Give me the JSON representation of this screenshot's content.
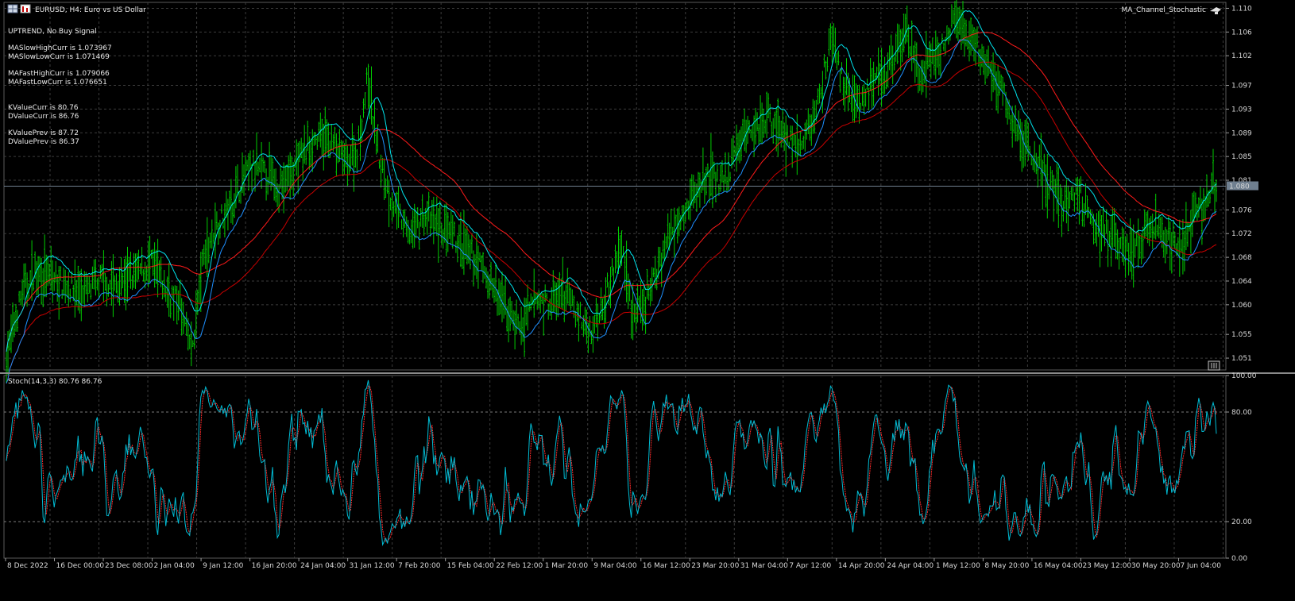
{
  "header": {
    "symbol_label": "EURUSD, H4:  Euro vs US Dollar",
    "ea_label": "MA_Channel_Stochastic"
  },
  "info": {
    "signal": "UPTREND, No Buy Signal",
    "lines": [
      "MASlowHighCurr is 1.073967",
      "MASlowLowCurr is 1.071469",
      "MAFastHighCurr is 1.079066",
      "MAFastLowCurr is 1.076651",
      "KValueCurr is 80.76",
      "DValueCurr is 86.76",
      "KValuePrev is 87.72",
      "DValuePrev is 86.37"
    ]
  },
  "indicator": {
    "label": "Stoch(14,3,3) 80.76 86.76"
  },
  "price_axis": {
    "ticks": [
      "1.110",
      "1.106",
      "1.102",
      "1.097",
      "1.093",
      "1.089",
      "1.085",
      "1.081",
      "1.076",
      "1.072",
      "1.068",
      "1.064",
      "1.060",
      "1.055",
      "1.051"
    ],
    "current_price": "1.080"
  },
  "stoch_axis": {
    "ticks": [
      "100.00",
      "80.00",
      "20.00",
      "0.00"
    ]
  },
  "time_axis": {
    "labels": [
      "8 Dec 2022",
      "16 Dec 00:00",
      "23 Dec 08:00",
      "2 Jan 04:00",
      "9 Jan 12:00",
      "16 Jan 20:00",
      "24 Jan 04:00",
      "31 Jan 12:00",
      "7 Feb 20:00",
      "15 Feb 04:00",
      "22 Feb 12:00",
      "1 Mar 20:00",
      "9 Mar 04:00",
      "16 Mar 12:00",
      "23 Mar 20:00",
      "31 Mar 04:00",
      "7 Apr 12:00",
      "14 Apr 20:00",
      "24 Apr 04:00",
      "1 May 12:00",
      "8 May 20:00",
      "16 May 04:00",
      "23 May 12:00",
      "30 May 20:00",
      "7 Jun 04:00"
    ]
  },
  "chart_data": {
    "type": "line",
    "price_range": [
      1.049,
      1.111
    ],
    "current_price": 1.08,
    "price_path": [
      [
        0,
        1.051
      ],
      [
        20,
        1.062
      ],
      [
        40,
        1.066
      ],
      [
        60,
        1.064
      ],
      [
        80,
        1.063
      ],
      [
        100,
        1.062
      ],
      [
        120,
        1.064
      ],
      [
        140,
        1.063
      ],
      [
        160,
        1.065
      ],
      [
        185,
        1.067
      ],
      [
        200,
        1.063
      ],
      [
        220,
        1.06
      ],
      [
        235,
        1.052
      ],
      [
        250,
        1.068
      ],
      [
        265,
        1.073
      ],
      [
        280,
        1.076
      ],
      [
        295,
        1.08
      ],
      [
        310,
        1.083
      ],
      [
        330,
        1.082
      ],
      [
        350,
        1.08
      ],
      [
        370,
        1.084
      ],
      [
        390,
        1.088
      ],
      [
        410,
        1.088
      ],
      [
        430,
        1.084
      ],
      [
        445,
        1.086
      ],
      [
        458,
        1.098
      ],
      [
        475,
        1.083
      ],
      [
        490,
        1.077
      ],
      [
        510,
        1.072
      ],
      [
        530,
        1.075
      ],
      [
        550,
        1.073
      ],
      [
        575,
        1.07
      ],
      [
        600,
        1.067
      ],
      [
        620,
        1.062
      ],
      [
        640,
        1.058
      ],
      [
        655,
        1.056
      ],
      [
        670,
        1.061
      ],
      [
        690,
        1.06
      ],
      [
        710,
        1.062
      ],
      [
        725,
        1.058
      ],
      [
        740,
        1.055
      ],
      [
        760,
        1.062
      ],
      [
        780,
        1.07
      ],
      [
        795,
        1.058
      ],
      [
        810,
        1.06
      ],
      [
        830,
        1.068
      ],
      [
        850,
        1.075
      ],
      [
        870,
        1.078
      ],
      [
        890,
        1.082
      ],
      [
        910,
        1.08
      ],
      [
        930,
        1.088
      ],
      [
        950,
        1.09
      ],
      [
        965,
        1.092
      ],
      [
        985,
        1.089
      ],
      [
        1005,
        1.086
      ],
      [
        1025,
        1.092
      ],
      [
        1045,
        1.105
      ],
      [
        1060,
        1.098
      ],
      [
        1080,
        1.094
      ],
      [
        1100,
        1.097
      ],
      [
        1120,
        1.1
      ],
      [
        1140,
        1.106
      ],
      [
        1160,
        1.098
      ],
      [
        1180,
        1.102
      ],
      [
        1205,
        1.108
      ],
      [
        1225,
        1.104
      ],
      [
        1245,
        1.1
      ],
      [
        1265,
        1.095
      ],
      [
        1285,
        1.088
      ],
      [
        1300,
        1.086
      ],
      [
        1320,
        1.081
      ],
      [
        1340,
        1.077
      ],
      [
        1360,
        1.079
      ],
      [
        1380,
        1.074
      ],
      [
        1400,
        1.072
      ],
      [
        1420,
        1.069
      ],
      [
        1435,
        1.07
      ],
      [
        1450,
        1.073
      ],
      [
        1470,
        1.071
      ],
      [
        1490,
        1.07
      ],
      [
        1505,
        1.075
      ],
      [
        1520,
        1.077
      ],
      [
        1534,
        1.08
      ]
    ],
    "series": [
      {
        "name": "",
        "color": "#00cc00",
        "role": "price bars"
      },
      {
        "name": "",
        "color": "#00e5ee",
        "role": "fast MA high"
      },
      {
        "name": "",
        "color": "#1e90ff",
        "role": "fast MA low"
      },
      {
        "name": "",
        "color": "#ff1a1a",
        "role": "slow MA high"
      },
      {
        "name": "",
        "color": "#c80000",
        "role": "slow MA low"
      }
    ],
    "stochastic": {
      "range": [
        0,
        100
      ],
      "levels": [
        20,
        80
      ],
      "k_color": "#00bcd4",
      "d_color": "#ff2a2a",
      "k_curr": 80.76,
      "d_curr": 86.76,
      "k_prev": 87.72,
      "d_prev": 86.37
    }
  }
}
